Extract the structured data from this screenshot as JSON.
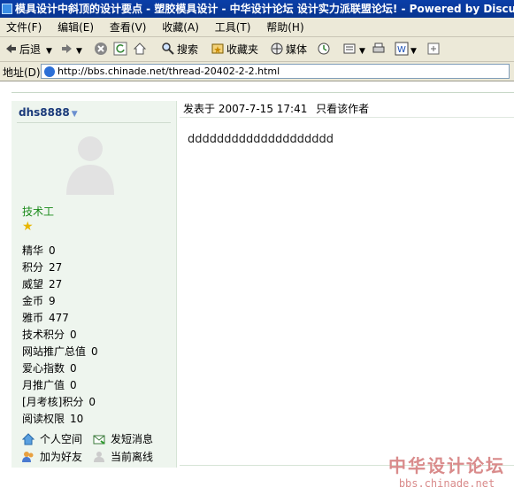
{
  "window": {
    "title": "模具设计中斜顶的设计要点 - 塑胶模具设计 - 中华设计论坛 设计实力派联盟论坛! - Powered by Discuz"
  },
  "menu": {
    "items": [
      "文件(F)",
      "编辑(E)",
      "查看(V)",
      "收藏(A)",
      "工具(T)",
      "帮助(H)"
    ]
  },
  "toolbar": {
    "back_label": "后退",
    "search_label": "搜索",
    "favorites_label": "收藏夹",
    "media_label": "媒体"
  },
  "address": {
    "label": "地址(D)",
    "url": "http://bbs.chinade.net/thread-20402-2-2.html"
  },
  "user": {
    "name": "dhs8888",
    "rank": "技术工",
    "stats": [
      {
        "label": "精华",
        "value": "0"
      },
      {
        "label": "积分",
        "value": "27"
      },
      {
        "label": "威望",
        "value": "27"
      },
      {
        "label": "金币",
        "value": "9"
      },
      {
        "label": "雅币",
        "value": "477"
      },
      {
        "label": "技术积分",
        "value": "0"
      },
      {
        "label": "网站推广总值",
        "value": "0"
      },
      {
        "label": "爱心指数",
        "value": "0"
      },
      {
        "label": "月推广值",
        "value": "0"
      },
      {
        "label": "[月考核]积分",
        "value": "0"
      },
      {
        "label": "阅读权限",
        "value": "10"
      }
    ],
    "actions": {
      "space": "个人空间",
      "message": "发短消息",
      "add_friend": "加为好友",
      "status": "当前离线"
    }
  },
  "post": {
    "posted_label": "发表于",
    "datetime": "2007-7-15 17:41",
    "author_only": "只看该作者",
    "content": "dddddddddddddddddddd"
  },
  "watermark": {
    "cn": "中华设计论坛",
    "en": "bbs.chinade.net"
  },
  "colors": {
    "titlebar": "#0a3ea8",
    "chrome": "#ece9d8",
    "profile_bg": "#eef5ee",
    "rank_green": "#1a8a1a",
    "watermark": "#d98b8b"
  }
}
